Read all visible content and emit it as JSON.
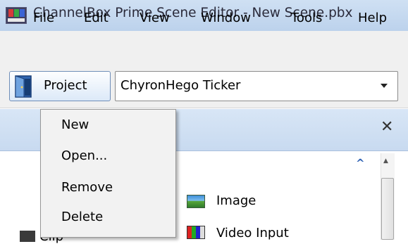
{
  "window": {
    "title": "ChannelBox Prime Scene Editor - New Scene.pbx"
  },
  "menubar": {
    "items": [
      "File",
      "Edit",
      "View",
      "Window",
      "Tools",
      "Help"
    ]
  },
  "toolbar": {
    "project_label": "Project",
    "scene_select_value": "ChyronHego Ticker"
  },
  "project_menu": {
    "items": [
      "New",
      "Open...",
      "Remove",
      "Delete"
    ]
  },
  "panel": {
    "items": [
      {
        "label": "Image",
        "icon": "image-icon"
      },
      {
        "label": "Video Input",
        "icon": "video-input-icon"
      },
      {
        "label": "Clip",
        "icon": "clip-icon"
      }
    ]
  },
  "colors": {
    "titlebar": "#c8daf0",
    "menu_bg": "#f0f0f0",
    "accent": "#2f62b4"
  }
}
